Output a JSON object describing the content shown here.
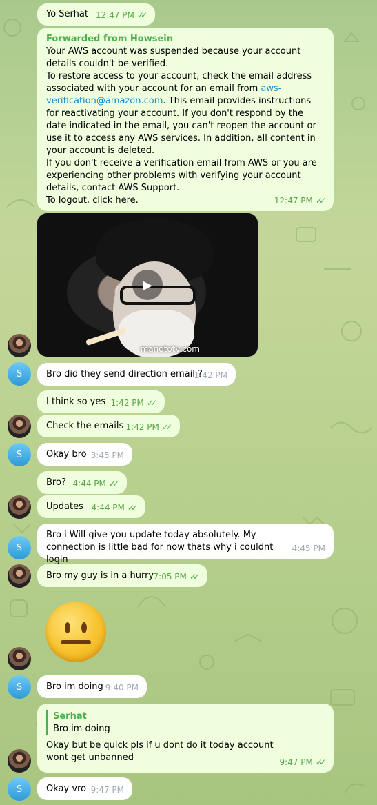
{
  "colors": {
    "outgoing_bubble": "#effedd",
    "incoming_bubble": "#ffffff",
    "outgoing_time": "#5aa54d",
    "incoming_time": "#a0acb6",
    "forward_name": "#4fae4e",
    "link": "#168acd"
  },
  "avatar_letter": "S",
  "messages": [
    {
      "text": "Yo Serhat",
      "time": "12:47 PM",
      "dir": "out"
    },
    {
      "forwarded_label": "Forwarded from Howsein",
      "lines": [
        "Your AWS account was suspended because your account details couldn't be verified.",
        "To restore access to your account, check the email address associated with your account for an email from ",
        "aws-verification@amazon.com",
        ". This email provides instructions for reactivating your account. If you don't respond by the date indicated in the email, you can't reopen the account or use it to access any AWS services. In addition, all content in your account is deleted.",
        "If you don't receive a verification email from AWS or you are experiencing other problems with verifying your account details, contact AWS Support.",
        "To logout, click here."
      ],
      "time": "12:47 PM",
      "dir": "out"
    },
    {
      "video_watermark": "manototv.com",
      "dir": "out"
    },
    {
      "text": "Bro did they send direction email ?",
      "time": "1:42 PM",
      "dir": "in"
    },
    {
      "text": "I think so yes",
      "time": "1:42 PM",
      "dir": "out"
    },
    {
      "text": "Check the emails",
      "time": "1:42 PM",
      "dir": "out"
    },
    {
      "text": "Okay bro",
      "time": "3:45 PM",
      "dir": "in"
    },
    {
      "text": "Bro?",
      "time": "4:44 PM",
      "dir": "out"
    },
    {
      "text": "Updates",
      "time": "4:44 PM",
      "dir": "out"
    },
    {
      "text": "Bro i Will give you update today absolutely. My connection is little bad for now thats why i couldnt login",
      "time": "4:45 PM",
      "dir": "in"
    },
    {
      "text": "Bro my guy is in a hurry",
      "time": "7:05 PM",
      "dir": "out"
    },
    {
      "emoji": "neutral-face",
      "dir": "out"
    },
    {
      "text": "Bro im doing",
      "time": "9:40 PM",
      "dir": "in"
    },
    {
      "reply_name": "Serhat",
      "reply_text": "Bro im doing",
      "text": "Okay but be quick pls if u dont do it today account wont get unbanned",
      "time": "9:47 PM",
      "dir": "out"
    },
    {
      "text": "Okay vro",
      "time": "9:47 PM",
      "dir": "in"
    }
  ]
}
